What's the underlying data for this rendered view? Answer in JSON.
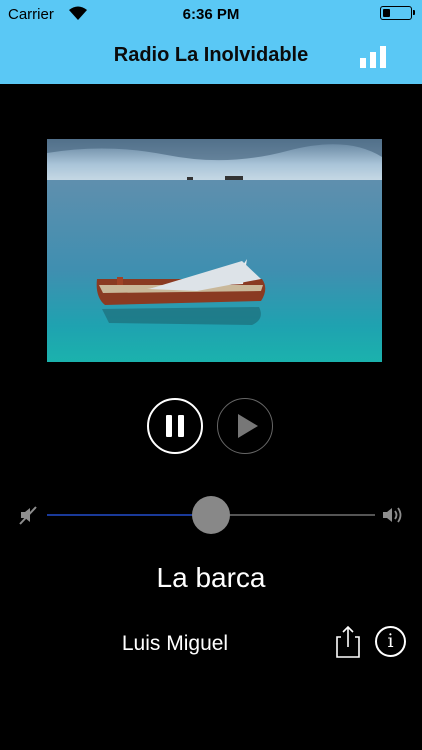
{
  "status_bar": {
    "carrier": "Carrier",
    "time": "6:36 PM",
    "battery_level": 0.25
  },
  "header": {
    "title": "Radio La Inolvidable",
    "signal_icon": "signal-bars-icon"
  },
  "player": {
    "artwork_icon": "album-artwork",
    "pause_icon": "pause-icon",
    "play_icon": "play-icon",
    "volume_level": 0.5,
    "song": "La barca",
    "artist": "Luis Miguel",
    "share_icon": "share-icon",
    "info_icon": "info-icon",
    "info_glyph": "i"
  },
  "colors": {
    "header_bg": "#5ac8f5",
    "background": "#000000",
    "volume_fill": "#1a3a9a"
  }
}
